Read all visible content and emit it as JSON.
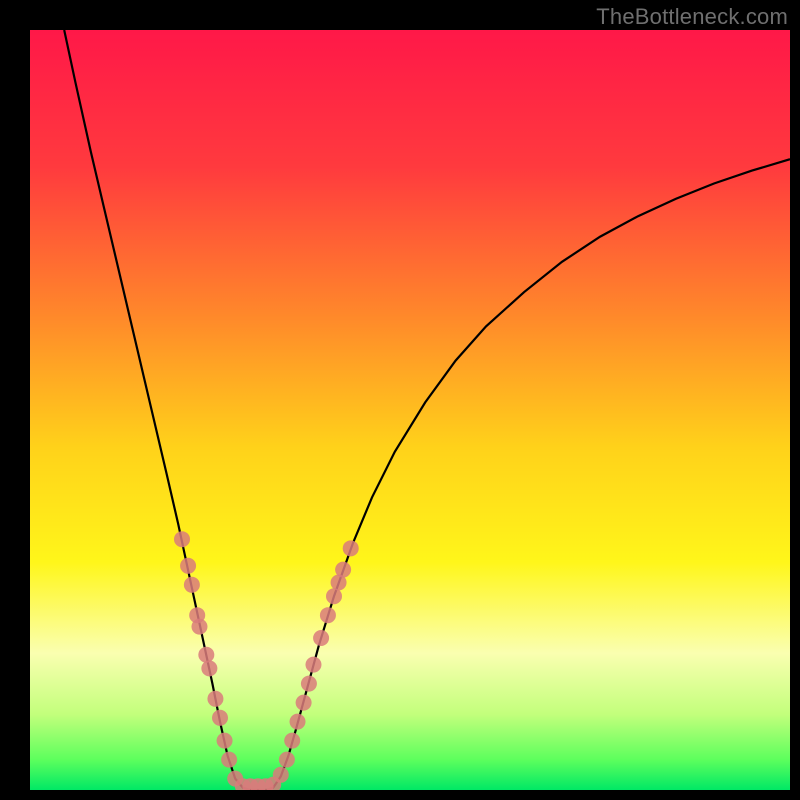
{
  "watermark": "TheBottleneck.com",
  "chart_data": {
    "type": "line",
    "title": "",
    "xlabel": "",
    "ylabel": "",
    "xlim": [
      0,
      100
    ],
    "ylim": [
      0,
      100
    ],
    "gradient_stops": [
      {
        "offset": 0,
        "color": "#ff1848"
      },
      {
        "offset": 18,
        "color": "#ff3a3e"
      },
      {
        "offset": 38,
        "color": "#ff8a2a"
      },
      {
        "offset": 55,
        "color": "#ffd21a"
      },
      {
        "offset": 70,
        "color": "#fff61a"
      },
      {
        "offset": 82,
        "color": "#faffb0"
      },
      {
        "offset": 90,
        "color": "#c3ff7c"
      },
      {
        "offset": 96,
        "color": "#5dff5d"
      },
      {
        "offset": 100,
        "color": "#00e865"
      }
    ],
    "series": [
      {
        "name": "bottleneck-curve",
        "type": "line",
        "points": [
          {
            "x": 4.5,
            "y": 100.0
          },
          {
            "x": 6.0,
            "y": 93.0
          },
          {
            "x": 8.0,
            "y": 84.0
          },
          {
            "x": 10.0,
            "y": 75.5
          },
          {
            "x": 12.0,
            "y": 67.0
          },
          {
            "x": 14.0,
            "y": 58.5
          },
          {
            "x": 16.0,
            "y": 50.0
          },
          {
            "x": 18.0,
            "y": 41.5
          },
          {
            "x": 19.5,
            "y": 35.0
          },
          {
            "x": 21.0,
            "y": 28.0
          },
          {
            "x": 22.5,
            "y": 21.0
          },
          {
            "x": 24.0,
            "y": 14.0
          },
          {
            "x": 25.0,
            "y": 9.0
          },
          {
            "x": 26.0,
            "y": 4.5
          },
          {
            "x": 27.0,
            "y": 1.5
          },
          {
            "x": 28.0,
            "y": 0.3
          },
          {
            "x": 29.0,
            "y": 0.0
          },
          {
            "x": 30.0,
            "y": 0.0
          },
          {
            "x": 31.0,
            "y": 0.0
          },
          {
            "x": 32.0,
            "y": 0.3
          },
          {
            "x": 33.0,
            "y": 1.8
          },
          {
            "x": 34.0,
            "y": 4.5
          },
          {
            "x": 35.0,
            "y": 8.0
          },
          {
            "x": 36.5,
            "y": 13.5
          },
          {
            "x": 38.0,
            "y": 19.0
          },
          {
            "x": 40.0,
            "y": 25.5
          },
          {
            "x": 42.5,
            "y": 32.5
          },
          {
            "x": 45.0,
            "y": 38.5
          },
          {
            "x": 48.0,
            "y": 44.5
          },
          {
            "x": 52.0,
            "y": 51.0
          },
          {
            "x": 56.0,
            "y": 56.5
          },
          {
            "x": 60.0,
            "y": 61.0
          },
          {
            "x": 65.0,
            "y": 65.5
          },
          {
            "x": 70.0,
            "y": 69.5
          },
          {
            "x": 75.0,
            "y": 72.8
          },
          {
            "x": 80.0,
            "y": 75.5
          },
          {
            "x": 85.0,
            "y": 77.8
          },
          {
            "x": 90.0,
            "y": 79.8
          },
          {
            "x": 95.0,
            "y": 81.5
          },
          {
            "x": 100.0,
            "y": 83.0
          }
        ]
      },
      {
        "name": "data-points",
        "type": "scatter",
        "color": "#d97b7b",
        "points": [
          {
            "x": 20.0,
            "y": 33.0
          },
          {
            "x": 20.8,
            "y": 29.5
          },
          {
            "x": 21.3,
            "y": 27.0
          },
          {
            "x": 22.0,
            "y": 23.0
          },
          {
            "x": 22.3,
            "y": 21.5
          },
          {
            "x": 23.2,
            "y": 17.8
          },
          {
            "x": 23.6,
            "y": 16.0
          },
          {
            "x": 24.4,
            "y": 12.0
          },
          {
            "x": 25.0,
            "y": 9.5
          },
          {
            "x": 25.6,
            "y": 6.5
          },
          {
            "x": 26.2,
            "y": 4.0
          },
          {
            "x": 27.0,
            "y": 1.5
          },
          {
            "x": 28.0,
            "y": 0.5
          },
          {
            "x": 29.0,
            "y": 0.5
          },
          {
            "x": 30.0,
            "y": 0.5
          },
          {
            "x": 31.0,
            "y": 0.5
          },
          {
            "x": 32.0,
            "y": 0.7
          },
          {
            "x": 33.0,
            "y": 2.0
          },
          {
            "x": 33.8,
            "y": 4.0
          },
          {
            "x": 34.5,
            "y": 6.5
          },
          {
            "x": 35.2,
            "y": 9.0
          },
          {
            "x": 36.0,
            "y": 11.5
          },
          {
            "x": 36.7,
            "y": 14.0
          },
          {
            "x": 37.3,
            "y": 16.5
          },
          {
            "x": 38.3,
            "y": 20.0
          },
          {
            "x": 39.2,
            "y": 23.0
          },
          {
            "x": 40.0,
            "y": 25.5
          },
          {
            "x": 40.6,
            "y": 27.3
          },
          {
            "x": 41.2,
            "y": 29.0
          },
          {
            "x": 42.2,
            "y": 31.8
          }
        ]
      }
    ]
  }
}
